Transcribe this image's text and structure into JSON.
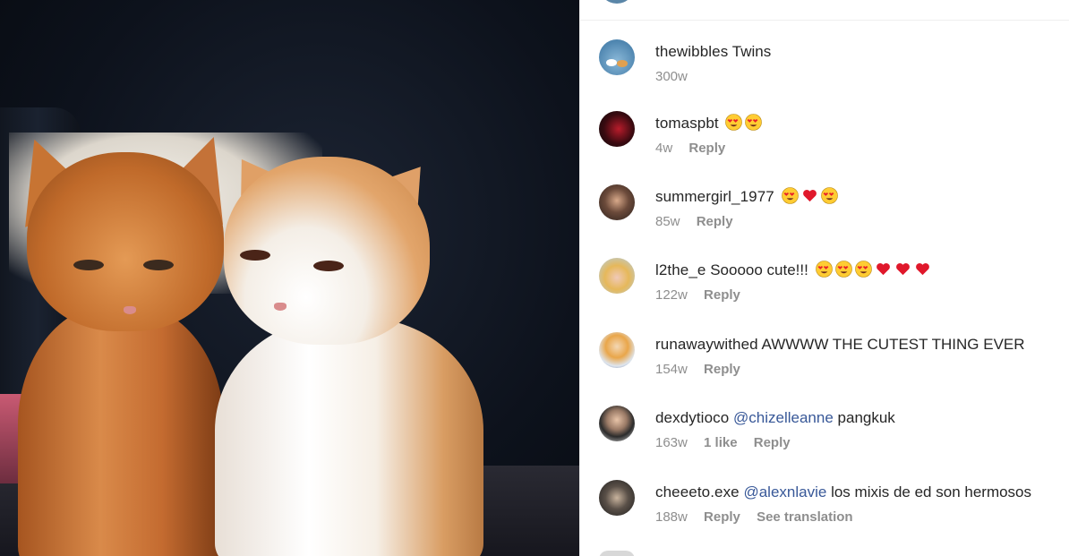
{
  "post": {
    "photo_alt": "Two kittens",
    "colors": {
      "link": "#385898",
      "meta": "#8e8e8e",
      "text": "#262626"
    }
  },
  "comments": [
    {
      "user": "thewibbles",
      "text": "Twins",
      "emojis": [],
      "time": "300w",
      "likes": "",
      "reply": "",
      "translate": "",
      "avatar": "cats-avatar"
    },
    {
      "user": "tomaspbt",
      "text": "",
      "emojis": [
        "heart-eyes",
        "heart-eyes"
      ],
      "time": "4w",
      "likes": "",
      "reply": "Reply",
      "translate": "",
      "avatar": "dark-red-avatar"
    },
    {
      "user": "summergirl_1977",
      "text": "",
      "emojis": [
        "heart-eyes",
        "red-heart",
        "heart-eyes"
      ],
      "time": "85w",
      "likes": "",
      "reply": "Reply",
      "translate": "",
      "avatar": "woman-avatar"
    },
    {
      "user": "l2the_e",
      "text": "Sooooo cute!!!",
      "emojis": [
        "heart-eyes",
        "heart-eyes",
        "heart-eyes",
        "red-heart",
        "red-heart",
        "red-heart"
      ],
      "time": "122w",
      "likes": "",
      "reply": "Reply",
      "translate": "",
      "avatar": "blonde-avatar"
    },
    {
      "user": "runawaywithed",
      "text": "AWWWW THE CUTEST THING EVER",
      "emojis": [],
      "time": "154w",
      "likes": "",
      "reply": "Reply",
      "translate": "",
      "avatar": "person-avatar"
    },
    {
      "user": "dexdytioco",
      "mention": "@chizelleanne",
      "text": "pangkuk",
      "emojis": [],
      "time": "163w",
      "likes": "1 like",
      "reply": "Reply",
      "translate": "",
      "avatar": "man-avatar"
    },
    {
      "user": "cheeeto.exe",
      "mention": "@alexnlavie",
      "text": "los mixis de ed son hermosos",
      "emojis": [],
      "time": "188w",
      "likes": "",
      "reply": "Reply",
      "translate": "See translation",
      "avatar": "cap-avatar"
    }
  ]
}
